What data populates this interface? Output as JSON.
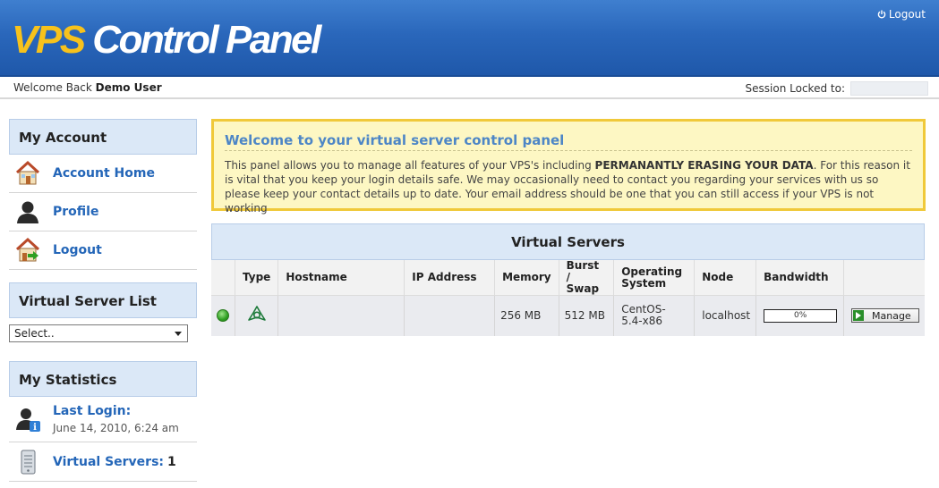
{
  "header": {
    "logo_primary": "VPS",
    "logo_secondary": " Control Panel",
    "logout_label": "Logout"
  },
  "welcome_bar": {
    "welcome_prefix": "Welcome Back ",
    "user_name": "Demo User",
    "session_label": "Session Locked to:"
  },
  "sidebar": {
    "account": {
      "title": "My Account",
      "items": [
        {
          "label": "Account Home",
          "icon": "home-icon"
        },
        {
          "label": "Profile",
          "icon": "user-icon"
        },
        {
          "label": "Logout",
          "icon": "home-logout-icon"
        }
      ]
    },
    "server_list": {
      "title": "Virtual Server List",
      "selected": "Select.."
    },
    "statistics": {
      "title": "My Statistics",
      "last_login_label": "Last Login:",
      "last_login_value": "June 14, 2010, 6:24 am",
      "virtual_servers_label": "Virtual Servers:",
      "virtual_servers_count": "1"
    }
  },
  "notice": {
    "title": "Welcome to your virtual server control panel",
    "text_before": "This panel allows you to manage all features of your VPS's including ",
    "text_bold": "PERMANANTLY ERASING YOUR DATA",
    "text_after": ". For this reason it is vital that you keep your login details safe. We may occasionally need to contact you regarding your services with us so please keep your contact details up to date. Your email address should be one that you can still access if your VPS is not working"
  },
  "virtual_servers": {
    "title": "Virtual Servers",
    "columns": [
      "Type",
      "Hostname",
      "IP Address",
      "Memory",
      "Burst / Swap",
      "Operating System",
      "Node",
      "Bandwidth"
    ],
    "rows": [
      {
        "status": "online",
        "type_icon": "openvz-icon",
        "hostname": "",
        "ip": "",
        "memory": "256 MB",
        "burst": "512 MB",
        "os": "CentOS-5.4-x86",
        "node": "localhost",
        "bandwidth": "0%",
        "bandwidth_fraction": 0,
        "action_label": "Manage"
      }
    ]
  },
  "colors": {
    "header_blue": "#2a67bb",
    "logo_yellow": "#f7c21c",
    "link_blue": "#2466b8",
    "notice_bg": "#fdf7c3",
    "notice_border": "#f0c93a",
    "panel_head_bg": "#dbe8f7",
    "status_green": "#2f9f22"
  }
}
